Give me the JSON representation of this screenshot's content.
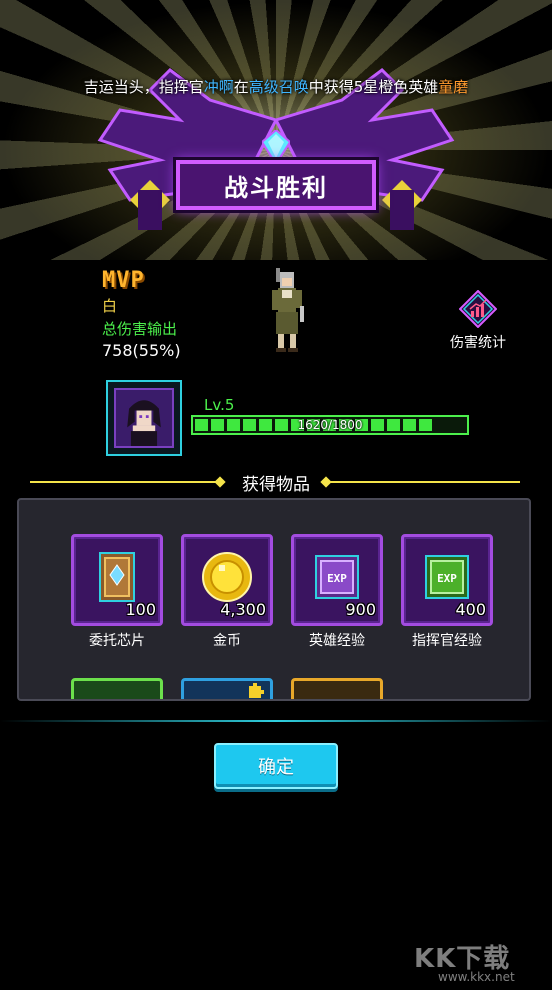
{
  "announcement": {
    "part1": "吉运当头，指挥官",
    "player": "冲啊",
    "part2": "在",
    "pool": "高级召唤",
    "part3": "中获得5星橙色英雄",
    "hero": "童磨"
  },
  "banner": {
    "title": "战斗胜利"
  },
  "mvp": {
    "logo": "MVP",
    "name": "白",
    "damage_label": "总伤害输出",
    "damage_value": "758(55%)"
  },
  "stats_button": {
    "label": "伤害统计",
    "icon": "damage-stats-icon"
  },
  "hero_level": {
    "level_label": "Lv.5",
    "xp_text": "1620/1800",
    "xp_fraction": 0.9
  },
  "rewards": {
    "title": "获得物品",
    "items": [
      {
        "name": "委托芯片",
        "count": "100",
        "icon": "chip-card-icon"
      },
      {
        "name": "金币",
        "count": "4,300",
        "icon": "gold-coin-icon"
      },
      {
        "name": "英雄经验",
        "count": "900",
        "icon": "hero-exp-book-icon"
      },
      {
        "name": "指挥官经验",
        "count": "400",
        "icon": "commander-exp-book-icon"
      }
    ]
  },
  "confirm_button": {
    "label": "确定"
  },
  "watermark": {
    "text": "KK下载",
    "url": "www.kkx.net"
  },
  "colors": {
    "accent_cyan": "#1ec8ef",
    "frame_purple": "#a34ce0",
    "xp_green": "#3fe83f",
    "highlight_blue": "#3fb6ff",
    "highlight_orange": "#ff9a2e"
  }
}
